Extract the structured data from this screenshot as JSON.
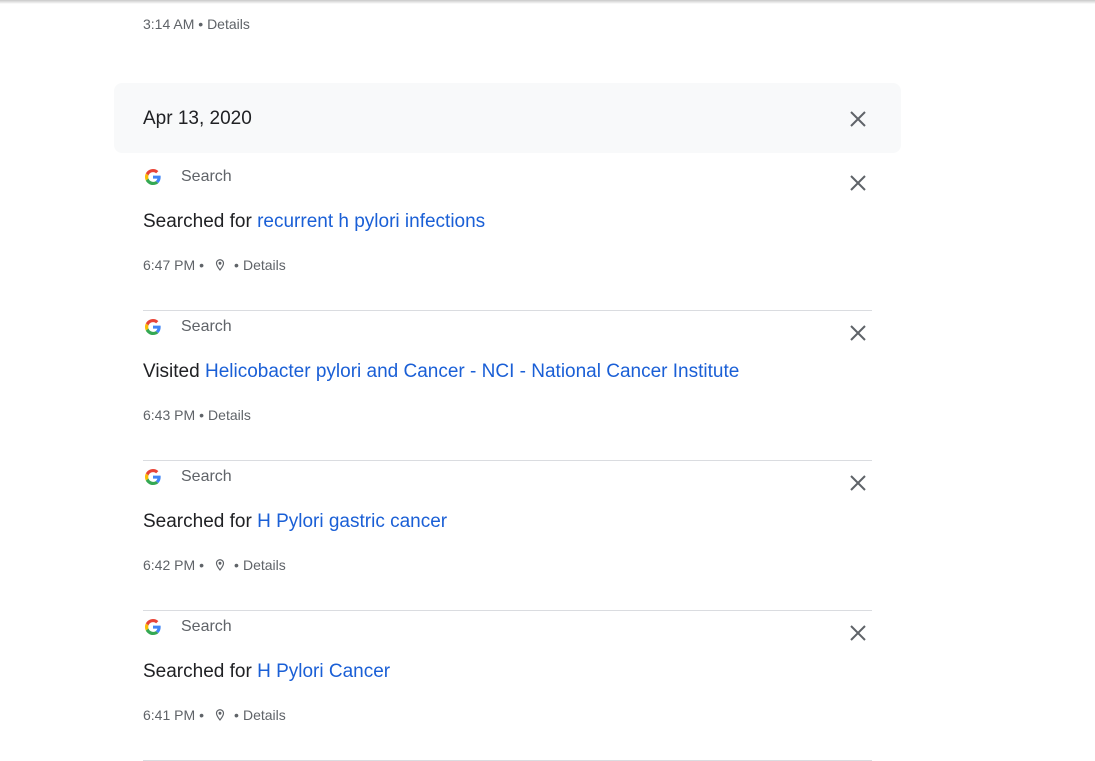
{
  "previous_item": {
    "time": "3:14 AM",
    "details_label": "Details"
  },
  "group": {
    "date": "Apr 13, 2020"
  },
  "icons": {
    "close": "close-icon",
    "google": "google-g-icon",
    "location": "location-pin-icon"
  },
  "colors": {
    "link": "#1a5fd6",
    "header_bg": "#f8f9fa",
    "muted": "#5f6368"
  },
  "items": [
    {
      "product": "Search",
      "action": "Searched for",
      "link": "recurrent h pylori infections",
      "time": "6:47 PM",
      "has_location": true,
      "details_label": "Details"
    },
    {
      "product": "Search",
      "action": "Visited",
      "link": "Helicobacter pylori and Cancer - NCI - National Cancer Institute",
      "time": "6:43 PM",
      "has_location": false,
      "details_label": "Details"
    },
    {
      "product": "Search",
      "action": "Searched for",
      "link": "H Pylori gastric cancer",
      "time": "6:42 PM",
      "has_location": true,
      "details_label": "Details"
    },
    {
      "product": "Search",
      "action": "Searched for",
      "link": "H Pylori Cancer",
      "time": "6:41 PM",
      "has_location": true,
      "details_label": "Details"
    }
  ]
}
